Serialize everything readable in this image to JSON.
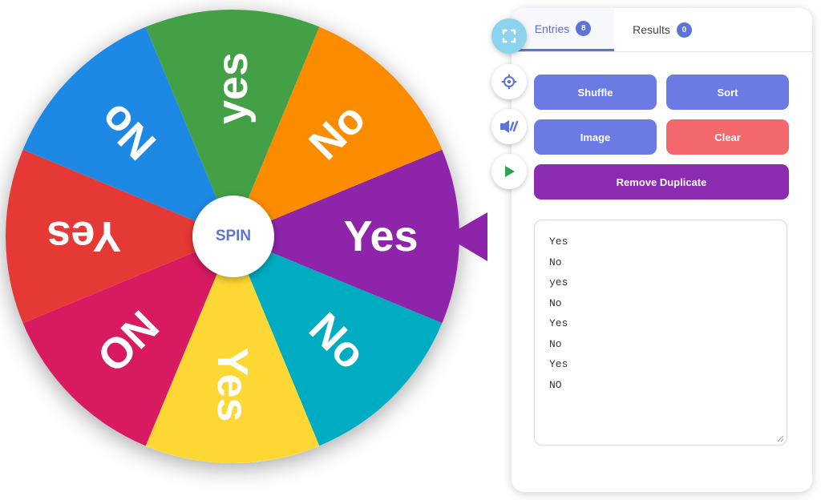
{
  "wheel": {
    "spin_label": "SPIN",
    "segments": [
      {
        "label": "Yes",
        "color": "#8e24aa"
      },
      {
        "label": "No",
        "color": "#00acc1"
      },
      {
        "label": "Yes",
        "color": "#fdd835"
      },
      {
        "label": "NO",
        "color": "#d81b60"
      },
      {
        "label": "Yes",
        "color": "#e53935"
      },
      {
        "label": "No",
        "color": "#1e88e5"
      },
      {
        "label": "yes",
        "color": "#43a047"
      },
      {
        "label": "No",
        "color": "#fb8c00"
      }
    ],
    "pointer_color": "#8e24aa"
  },
  "side_buttons": [
    {
      "icon": "fullscreen-icon"
    },
    {
      "icon": "settings-gear-icon"
    },
    {
      "icon": "share-icon"
    },
    {
      "icon": "play-icon"
    }
  ],
  "panel": {
    "tabs": {
      "entries": {
        "label": "Entries",
        "count": "8"
      },
      "results": {
        "label": "Results",
        "count": "0"
      }
    },
    "buttons": {
      "shuffle": "Shuffle",
      "sort": "Sort",
      "image": "Image",
      "clear": "Clear",
      "remove_duplicate": "Remove Duplicate"
    },
    "entries": [
      "Yes",
      "No",
      "yes",
      "No",
      "Yes",
      "No",
      "Yes",
      "NO"
    ]
  }
}
